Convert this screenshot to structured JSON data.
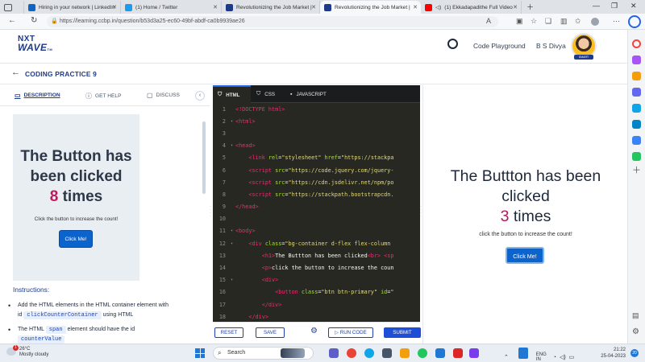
{
  "browser": {
    "tabs": [
      {
        "title": "Hiring in your network | LinkedIn",
        "active": false
      },
      {
        "title": "(1) Home / Twitter",
        "active": false
      },
      {
        "title": "Revolutionizing the Job Market |",
        "active": false
      },
      {
        "title": "Revolutionizing the Job Market |",
        "active": true
      },
      {
        "title": "(1) Ekkadapadithe Full Video",
        "active": false
      }
    ],
    "url": "https://learning.ccbp.in/question/b53d3a25-ec60-49bf-abdf-ca0b9939ae26"
  },
  "header": {
    "logo_line1": "NXT",
    "logo_line2": "WAVE",
    "logo_tm": "TM",
    "code_playground": "Code Playground",
    "user_name": "B S Divya",
    "avatar_badge": "SMART"
  },
  "page": {
    "title": "CODING PRACTICE 9"
  },
  "left_tabs": {
    "description": "DESCRIPTION",
    "get_help": "GET HELP",
    "discuss": "DISCUSS"
  },
  "preview": {
    "heading_line1": "The Button has",
    "heading_line2": "been clicked",
    "count": "8",
    "times": "times",
    "paragraph": "Click the button to increase the count!",
    "button": "Click Me!"
  },
  "instructions": {
    "heading": "Instructions:",
    "b1_pre": "Add the HTML elements in the HTML container element with",
    "b1_id": "id",
    "b1_chip": "clickCounterContainer",
    "b1_post": "using HTML",
    "b2_pre": "The HTML",
    "b2_chip": "span",
    "b2_post": "element should have the id",
    "b3_chip": "counterValue"
  },
  "editor": {
    "tabs": [
      "HTML",
      "CSS",
      "JAVASCRIPT"
    ],
    "lines": [
      {
        "n": "1",
        "fold": "",
        "html": "<span class=\"tag\">&lt;!DOCTYPE html&gt;</span>"
      },
      {
        "n": "2",
        "fold": "▾",
        "html": "<span class=\"tag\">&lt;html&gt;</span>"
      },
      {
        "n": "3",
        "fold": "",
        "html": ""
      },
      {
        "n": "4",
        "fold": "▾",
        "html": "<span class=\"tag\">&lt;head&gt;</span>"
      },
      {
        "n": "5",
        "fold": "",
        "html": "    <span class=\"tag\">&lt;link</span> <span class=\"attr\">rel</span>=<span class=\"str\">\"stylesheet\"</span> <span class=\"attr\">href</span>=<span class=\"str\">\"https://stackpa</span>"
      },
      {
        "n": "6",
        "fold": "",
        "html": "    <span class=\"tag\">&lt;script</span> <span class=\"attr\">src</span>=<span class=\"str\">\"https://code.jquery.com/jquery-</span>"
      },
      {
        "n": "7",
        "fold": "",
        "html": "    <span class=\"tag\">&lt;script</span> <span class=\"attr\">src</span>=<span class=\"str\">\"https://cdn.jsdelivr.net/npm/po</span>"
      },
      {
        "n": "8",
        "fold": "",
        "html": "    <span class=\"tag\">&lt;script</span> <span class=\"attr\">src</span>=<span class=\"str\">\"https://stackpath.bootstrapcdn.</span>"
      },
      {
        "n": "9",
        "fold": "",
        "html": "<span class=\"tag\">&lt;/head&gt;</span>"
      },
      {
        "n": "10",
        "fold": "",
        "html": ""
      },
      {
        "n": "11",
        "fold": "▾",
        "html": "<span class=\"tag\">&lt;body&gt;</span>"
      },
      {
        "n": "12",
        "fold": "▾",
        "html": "    <span class=\"tag\">&lt;div</span> <span class=\"attr\">class</span>=<span class=\"str\">\"bg-container d-flex flex-column</span>"
      },
      {
        "n": "13",
        "fold": "",
        "html": "        <span class=\"tag\">&lt;h1&gt;</span>The Buttton has been clicked<span class=\"tag\">&lt;br&gt;</span> <span class=\"tag\">&lt;sp</span>"
      },
      {
        "n": "14",
        "fold": "",
        "html": "        <span class=\"tag\">&lt;p&gt;</span>click the button to increase the coun"
      },
      {
        "n": "15",
        "fold": "▾",
        "html": "        <span class=\"tag\">&lt;div&gt;</span>"
      },
      {
        "n": "16",
        "fold": "",
        "html": "            <span class=\"tag\">&lt;button</span> <span class=\"attr\">class</span>=<span class=\"str\">\"btn btn-primary\"</span> <span class=\"attr\">id</span>=<span class=\"str\">\"</span>"
      },
      {
        "n": "17",
        "fold": "",
        "html": "        <span class=\"tag\">&lt;/div&gt;</span>"
      },
      {
        "n": "18",
        "fold": "",
        "html": "    <span class=\"tag\">&lt;/div&gt;</span>"
      }
    ],
    "reset": "RESET",
    "save": "SAVE",
    "run_code": "RUN CODE",
    "submit": "SUBMIT"
  },
  "output": {
    "heading_line1": "The Buttton has been",
    "heading_line2": "clicked",
    "count": "3",
    "times": "times",
    "paragraph": "click the button to increase the count!",
    "button": "Click Me!"
  },
  "taskbar": {
    "temperature": "26°C",
    "weather": "Mostly cloudy",
    "weather_badge": "1",
    "search": "Search",
    "lang1": "ENG",
    "lang2": "IN",
    "time": "21:22",
    "date": "25-04-2023",
    "notif_count": "20"
  },
  "colors": {
    "brand": "#1e3a8a",
    "primary_button": "#0b63ce",
    "count_accent": "#c0185d",
    "editor_bg": "#272822"
  }
}
